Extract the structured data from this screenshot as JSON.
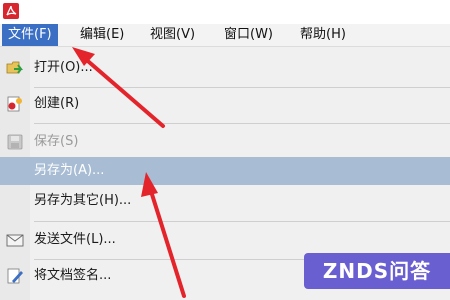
{
  "menubar": {
    "items": [
      {
        "label": "文件(F)",
        "active": true
      },
      {
        "label": "编辑(E)"
      },
      {
        "label": "视图(V)"
      },
      {
        "label": "窗口(W)"
      },
      {
        "label": "帮助(H)"
      }
    ]
  },
  "file_menu": {
    "items": [
      {
        "label": "打开(O)...",
        "icon": "open-folder-icon"
      },
      {
        "label": "创建(R)",
        "icon": "create-document-icon"
      },
      {
        "label": "保存(S)",
        "icon": "save-disk-icon",
        "state": "disabled"
      },
      {
        "label": "另存为(A)...",
        "state": "highlighted"
      },
      {
        "label": "另存为其它(H)..."
      },
      {
        "label": "发送文件(L)...",
        "icon": "envelope-icon"
      },
      {
        "label": "将文档签名...",
        "icon": "sign-pen-icon"
      }
    ]
  },
  "watermark": {
    "text": "ZNDS问答"
  },
  "colors": {
    "menu_active": "#3a6fc4",
    "highlight_row": "#a8bdd4",
    "arrow": "#e3242b",
    "watermark_bg": "#6a5fd0"
  }
}
